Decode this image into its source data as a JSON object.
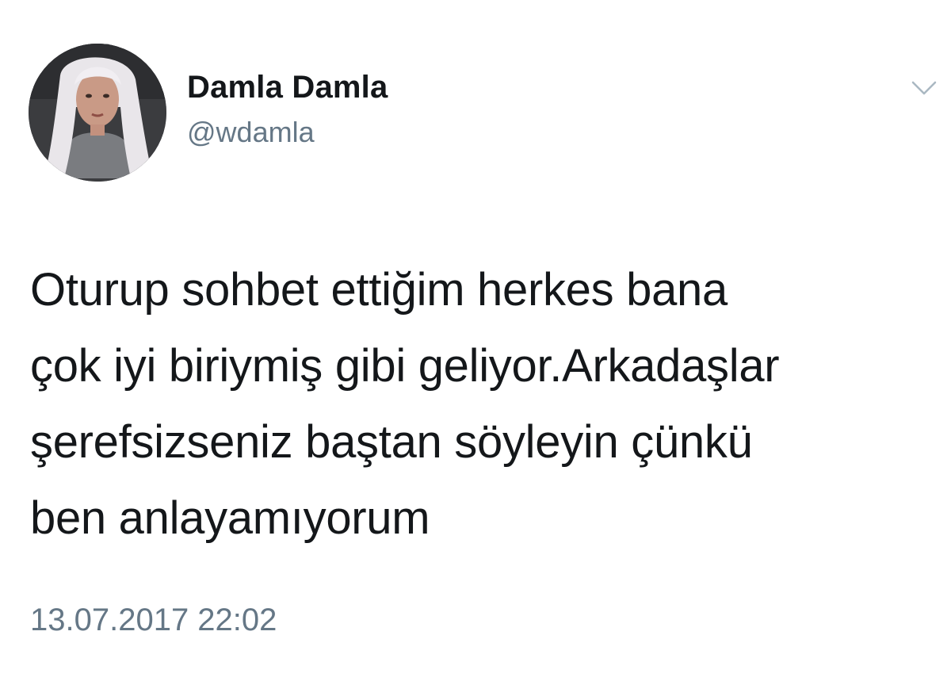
{
  "author": {
    "display_name": "Damla Damla",
    "handle": "@wdamla"
  },
  "tweet": {
    "lines": [
      "Oturup sohbet ettiğim herkes bana",
      "çok iyi biriymiş gibi geliyor.Arkadaşlar",
      "şerefsizseniz baştan söyleyin çünkü",
      "ben anlayamıyorum"
    ],
    "timestamp": "13.07.2017 22:02"
  },
  "icons": {
    "menu": "chevron-down-icon"
  },
  "colors": {
    "text_primary": "#14171a",
    "text_secondary": "#657786",
    "chevron": "#aab8c2",
    "background": "#ffffff"
  }
}
